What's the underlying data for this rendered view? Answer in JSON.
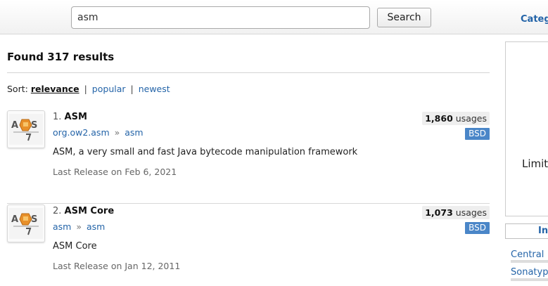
{
  "search": {
    "value": "asm",
    "button_label": "Search"
  },
  "header": {
    "categories_label": "Categ"
  },
  "results_title": "Found 317 results",
  "sort": {
    "label": "Sort:",
    "options": [
      "relevance",
      "popular",
      "newest"
    ],
    "separator": "|",
    "active": "relevance"
  },
  "results": [
    {
      "rank": "1.",
      "name": "ASM",
      "group": "org.ow2.asm",
      "artifact": "asm",
      "arrow": "»",
      "description": "ASM, a very small and fast Java bytecode manipulation framework",
      "release": "Last Release on Feb 6, 2021",
      "usages_count": "1,860",
      "usages_label": "usages",
      "license": "BSD",
      "logo_icon": "asm-logo-icon"
    },
    {
      "rank": "2.",
      "name": "ASM Core",
      "group": "asm",
      "artifact": "asm",
      "arrow": "»",
      "description": "ASM Core",
      "release": "Last Release on Jan 12, 2011",
      "usages_count": "1,073",
      "usages_label": "usages",
      "license": "BSD",
      "logo_icon": "asm-logo-icon"
    }
  ],
  "sidebar": {
    "box_text": "Limit",
    "tab_label": "In",
    "repositories": [
      "Central",
      "Sonatype"
    ]
  },
  "colors": {
    "link": "#2464a8",
    "license_badge": "#4a86c8",
    "logo_orange": "#e8902a"
  }
}
